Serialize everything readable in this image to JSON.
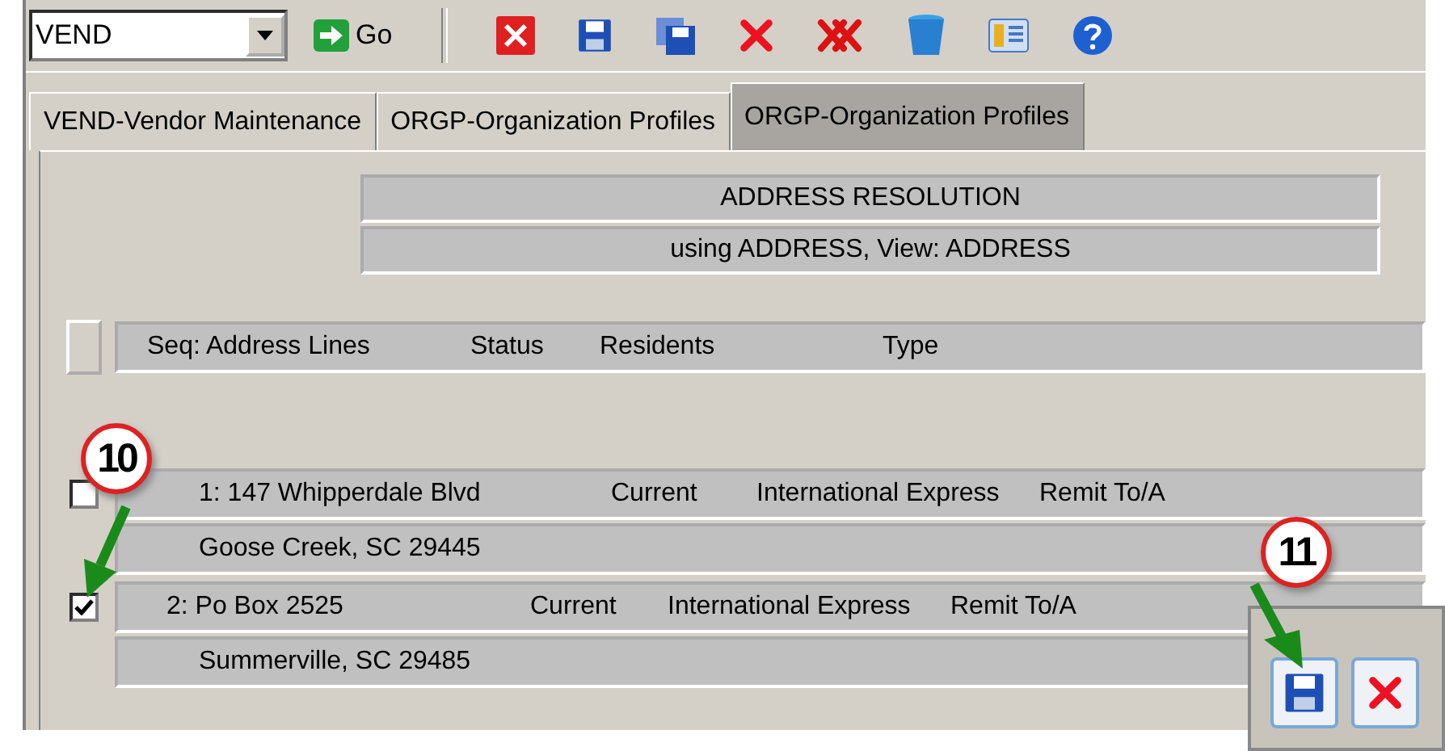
{
  "toolbar": {
    "combo_value": "VEND",
    "go_label": "Go"
  },
  "tabs": [
    {
      "label": "VEND-Vendor Maintenance",
      "selected": false
    },
    {
      "label": "ORGP-Organization Profiles",
      "selected": false
    },
    {
      "label": "ORGP-Organization Profiles",
      "selected": true
    }
  ],
  "header": {
    "title": "ADDRESS RESOLUTION",
    "subtitle": "using ADDRESS, View: ADDRESS"
  },
  "columns": [
    "Seq: Address Lines",
    "Status",
    "Residents",
    "Type"
  ],
  "records": [
    {
      "checked": false,
      "seq": "1: 147 Whipperdale Blvd",
      "status": "Current",
      "residents": "International Express",
      "type": "Remit To/A",
      "line_2": "Goose Creek, SC 29445"
    },
    {
      "checked": true,
      "seq": "2: Po Box 2525",
      "status": "Current",
      "residents": "International Express",
      "type": "Remit To/A",
      "line_2": "Summerville, SC 29485"
    }
  ],
  "callouts": [
    "10",
    "11"
  ]
}
